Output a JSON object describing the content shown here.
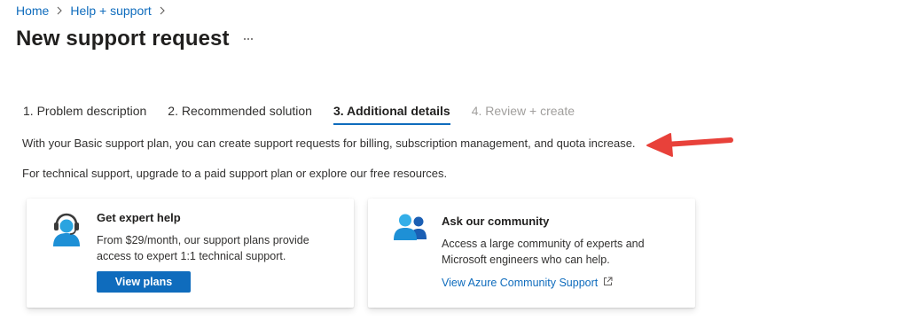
{
  "breadcrumb": {
    "items": [
      "Home",
      "Help + support"
    ]
  },
  "page": {
    "title": "New support request",
    "more_icon": "more-horizontal-icon"
  },
  "tabs": [
    {
      "label": "1. Problem description",
      "state": "default"
    },
    {
      "label": "2. Recommended solution",
      "state": "default"
    },
    {
      "label": "3. Additional details",
      "state": "active"
    },
    {
      "label": "4. Review + create",
      "state": "disabled"
    }
  ],
  "info": {
    "line1": "With your Basic support plan, you can create support requests for billing, subscription management, and quota increase.",
    "line2": "For technical support, upgrade to a paid support plan or explore our free resources."
  },
  "cards": {
    "expert": {
      "icon": "headset-person-icon",
      "title": "Get expert help",
      "description": "From $29/month, our support plans provide access to expert 1:1 technical support.",
      "button": "View plans"
    },
    "community": {
      "icon": "people-community-icon",
      "title": "Ask our community",
      "description": "Access a large community of experts and Microsoft engineers who can help.",
      "link": "View Azure Community Support",
      "link_icon": "external-link-icon"
    }
  },
  "colors": {
    "accent": "#0f6cbd",
    "arrow": "#e8413a",
    "icon_blue": "#1e90d6"
  }
}
